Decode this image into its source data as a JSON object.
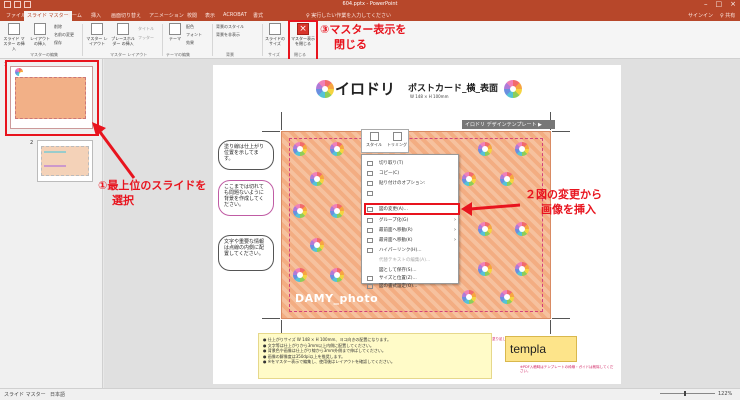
{
  "window": {
    "title": "604.pptx - PowerPoint",
    "controls": [
      "–",
      "□",
      "×"
    ]
  },
  "tabs": [
    {
      "label": "ファイル",
      "active": false
    },
    {
      "label": "スライド マスター",
      "active": true
    },
    {
      "label": "ホーム",
      "active": false
    },
    {
      "label": "挿入",
      "active": false
    },
    {
      "label": "画面切り替え",
      "active": false
    },
    {
      "label": "アニメーション",
      "active": false
    },
    {
      "label": "校閲",
      "active": false
    },
    {
      "label": "表示",
      "active": false
    },
    {
      "label": "ACROBAT",
      "active": false
    },
    {
      "label": "書式",
      "active": false
    }
  ],
  "tell_me": "♀ 実行したい作業を入力してください",
  "account": {
    "signin": "サインイン",
    "share": "♀ 共有"
  },
  "ribbon": {
    "insert_master": "スライド マスター の挿入",
    "insert_layout": "レイアウト の挿入",
    "delete": "削除",
    "rename": "名前の変更",
    "preserve": "保存",
    "master_layout": "マスター レイアウト",
    "placeholder": "プレースホルダー の挿入",
    "title_chk": "タイトル",
    "footer_chk": "フッター",
    "themes": "テーマ",
    "colors": "配色",
    "fonts": "フォント",
    "effects": "効果",
    "bg_styles": "背景のスタイル",
    "hide_bg": "背景を非表示",
    "slide_size": "スライドの サイズ",
    "close_master": "マスター表示 を閉じる",
    "group_edit_master": "マスターの編集",
    "group_master_layout": "マスター レイアウト",
    "group_edit_theme": "テーマの編集",
    "group_bg": "背景",
    "group_size": "サイズ",
    "group_close": "閉じる"
  },
  "annotations": {
    "step1": [
      "①最上位のスライドを",
      "選択"
    ],
    "step2": [
      "２図の変更から",
      "画像を挿入"
    ],
    "step3": [
      "③マスター表示を",
      "閉じる"
    ]
  },
  "pane": {
    "slide_number_1": "1",
    "slide_number_2": "2"
  },
  "slide": {
    "brand": "イロドリ",
    "title": "ポストカード_横_表面",
    "size": "W 148 × H 100mm",
    "template_badge": "イロドリ デザインテンプレート ▶",
    "dummy": "DAMY_photo",
    "bubbles": [
      "塗り線は仕上がり位置を示してます。",
      "ここまでは切れても問題ないように背景を作成してください。",
      "文字や重要な情報は点線の内側に配置してください。"
    ],
    "notes": [
      "● 仕上がりサイズ W 148 × H 100mm、ヨコ向きの配置になります。",
      "● 文字等は仕上がりから3mm以上内側に配置してください。",
      "● 背景色や画像は仕上がり線から3mm外側まで伸ばしてください。",
      "● 画像の解像度は350dpi以上を推奨します。",
      "● ※をマスター表示で編集し、使用後はレイアウトを確認してください。"
    ],
    "template_word": "templa",
    "template_note_top": "塗り足し",
    "template_note": "※PDF入稿時はテンプレートの枠線・ガイドは削除してください。"
  },
  "context_menu": {
    "mini_toolbar": [
      "スタイル",
      "トリミング"
    ],
    "items": [
      {
        "label": "切り取り(T)",
        "dim": false,
        "sub": false
      },
      {
        "label": "コピー(C)",
        "dim": false,
        "sub": false
      },
      {
        "label": "貼り付けのオプション:",
        "dim": false,
        "sub": false
      },
      {
        "label": "",
        "dim": false,
        "sub": false
      },
      {
        "label": "図の変更(A)...",
        "dim": false,
        "sub": false
      },
      {
        "label": "グループ化(G)",
        "dim": false,
        "sub": true
      },
      {
        "label": "最前面へ移動(R)",
        "dim": false,
        "sub": true
      },
      {
        "label": "最背面へ移動(K)",
        "dim": false,
        "sub": true
      },
      {
        "label": "ハイパーリンク(H)...",
        "dim": false,
        "sub": false
      },
      {
        "label": "代替テキストの編集(A)...",
        "dim": true,
        "sub": false
      },
      {
        "label": "図として保存(S)...",
        "dim": false,
        "sub": false
      },
      {
        "label": "サイズと位置(Z)...",
        "dim": false,
        "sub": false
      },
      {
        "label": "図の書式設定(O)...",
        "dim": false,
        "sub": false
      }
    ]
  },
  "status": {
    "mode": "スライド マスター",
    "lang": "日本語",
    "zoom": "122%"
  },
  "colors": {
    "accent": "#b7472a",
    "annotation": "#e8141e",
    "card": "#f3ad82"
  }
}
